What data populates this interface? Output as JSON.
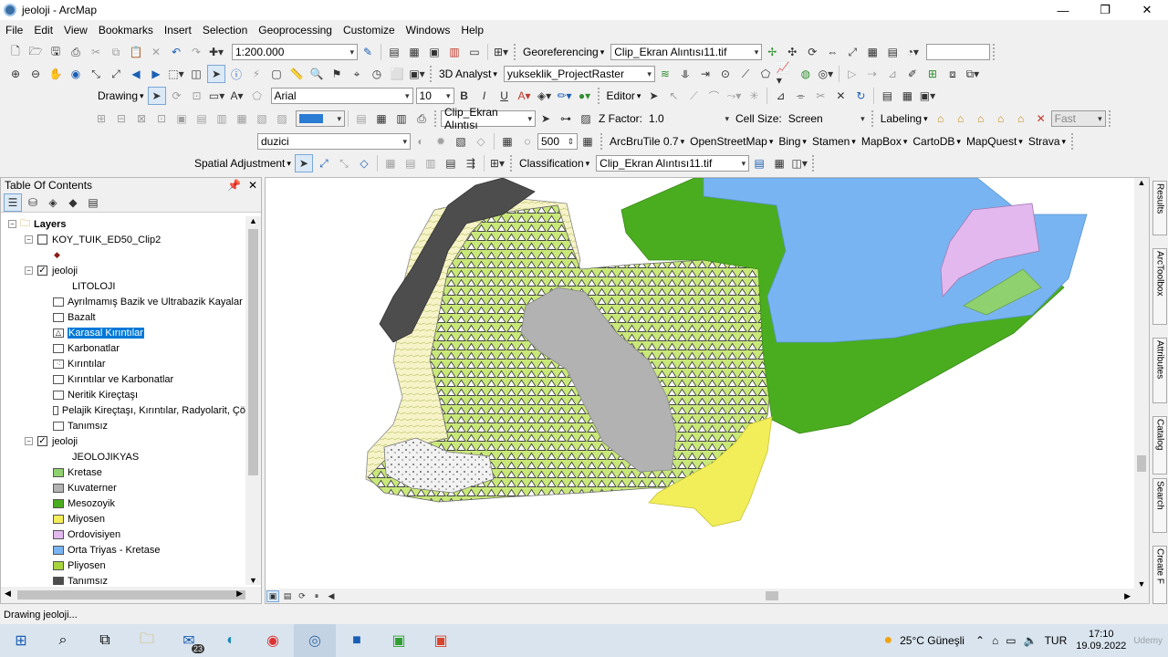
{
  "window": {
    "title": "jeoloji - ArcMap",
    "controls": [
      "—",
      "❐",
      "✕"
    ]
  },
  "menu": [
    "File",
    "Edit",
    "View",
    "Bookmarks",
    "Insert",
    "Selection",
    "Geoprocessing",
    "Customize",
    "Windows",
    "Help"
  ],
  "toolbar1": {
    "scale": "1:200.000",
    "georef_label": "Georeferencing",
    "georef_layer": "Clip_Ekran Alıntısı11.tif"
  },
  "toolbar2": {
    "analyst_label": "3D Analyst",
    "raster_layer": "yukseklik_ProjectRaster"
  },
  "toolbar3": {
    "drawing_label": "Drawing",
    "font": "Arial",
    "font_size": "10",
    "bold": "B",
    "italic": "I",
    "underline": "U",
    "editor_label": "Editor"
  },
  "toolbar4": {
    "clip_layer": "Clip_Ekran Alıntısı",
    "zfactor_label": "Z Factor:",
    "zfactor_value": "1.0",
    "cellsize_label": "Cell Size:",
    "cellsize_value": "Screen",
    "labeling_label": "Labeling",
    "fast_label": "Fast"
  },
  "toolbar5": {
    "layer": "duzici",
    "value": "500",
    "basemaps": [
      "ArcBruTile 0.7",
      "OpenStreetMap",
      "Bing",
      "Stamen",
      "MapBox",
      "CartoDB",
      "MapQuest",
      "Strava"
    ]
  },
  "toolbar6": {
    "spatial_adjustment": "Spatial Adjustment",
    "classification": "Classification",
    "class_layer": "Clip_Ekran Alıntısı11.tif"
  },
  "toc": {
    "title": "Table Of Contents",
    "layers_root": "Layers",
    "items": [
      {
        "label": "KOY_TUIK_ED50_Clip2",
        "type": "layer",
        "checked": false
      },
      {
        "label": "jeoloji",
        "type": "layer",
        "checked": true,
        "field": "LITOLOJI",
        "classes": [
          {
            "label": "Ayrılmamış Bazik ve Ultrabazik Kayalar",
            "pattern": "plain"
          },
          {
            "label": "Bazalt",
            "pattern": "plain"
          },
          {
            "label": "Karasal Kırıntılar",
            "pattern": "triangles",
            "selected": true
          },
          {
            "label": "Karbonatlar",
            "pattern": "plain"
          },
          {
            "label": "Kırıntılar",
            "pattern": "dots"
          },
          {
            "label": "Kırıntılar ve Karbonatlar",
            "pattern": "plain"
          },
          {
            "label": "Neritik Kireçtaşı",
            "pattern": "plain"
          },
          {
            "label": "Pelajik Kireçtaşı, Kırıntılar, Radyolarit, Çö",
            "pattern": "plain"
          },
          {
            "label": "Tanımsız",
            "pattern": "plain"
          }
        ]
      },
      {
        "label": "jeoloji",
        "type": "layer",
        "checked": true,
        "field": "JEOLOJIKYAS",
        "classes": [
          {
            "label": "Kretase",
            "color": "#8fd16e"
          },
          {
            "label": "Kuvaterner",
            "color": "#b2b2b2"
          },
          {
            "label": "Mesozoyik",
            "color": "#4aad1f"
          },
          {
            "label": "Miyosen",
            "color": "#f2ee5a"
          },
          {
            "label": "Ordovisiyen",
            "color": "#e2b8ef"
          },
          {
            "label": "Orta Triyas - Kretase",
            "color": "#79b4f2"
          },
          {
            "label": "Pliyosen",
            "color": "#a6d43c"
          },
          {
            "label": "Tanımsız",
            "color": "#4d4d4d"
          }
        ]
      }
    ]
  },
  "right_dock": [
    "Results",
    "ArcToolbox",
    "Attributes",
    "Catalog",
    "Search",
    "Create F"
  ],
  "status": "Drawing jeoloji...",
  "taskbar": {
    "mail_badge": "23",
    "weather": "25°C Güneşli",
    "lang": "TUR",
    "time": "17:10",
    "date": "19.09.2022",
    "watermark": "Udemy"
  }
}
